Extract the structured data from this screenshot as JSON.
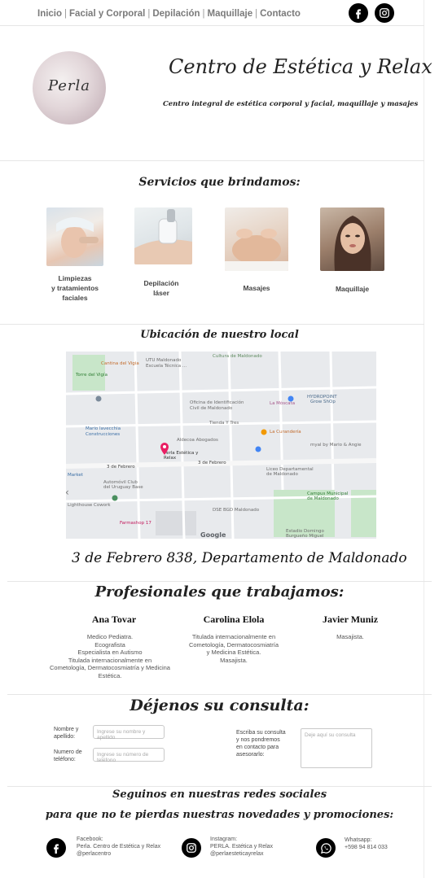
{
  "nav": {
    "items": [
      "Inicio",
      "Facial y Corporal",
      "Depilación",
      "Maquillaje",
      "Contacto"
    ],
    "separator": "|",
    "icons": [
      "facebook-icon",
      "instagram-icon"
    ]
  },
  "header": {
    "logo_text": "Perla",
    "title": "Centro de Estética y Relax",
    "subtitle": "Centro integral de estética corporal y facial, maquillaje y masajes"
  },
  "services": {
    "title": "Servicios que brindamos:",
    "items": [
      {
        "line1": "Limpiezas",
        "line2": "y tratamientos",
        "line3": "faciales"
      },
      {
        "line1": "Depilación",
        "line2": "láser"
      },
      {
        "line1": "Masajes"
      },
      {
        "line1": "Maquillaje"
      }
    ]
  },
  "location": {
    "title": "Ubicación de nuestro local",
    "address": "3 de Febrero 838, Departamento de Maldonado",
    "map_labels": {
      "cantina": "Cantina del Vigia",
      "utu": "UTU Maldonado",
      "utu2": "Escuela Técnica ...",
      "cultura": "Cultura de Maldonado",
      "torre": "Torre del Vigía",
      "hydropoint": "HYDROPOINT",
      "growshop": "Grow ShOp",
      "oficina": "Oficina de Identificación",
      "civil": "Civil de Maldonado",
      "moscata": "La Mòscata",
      "tienda": "Tienda Y Tres",
      "curanderia": "La Curandería",
      "mario": "Mario Iavecchia",
      "construcciones": "Construcciones",
      "aldecoa": "Aldecoa Abogados",
      "perla": "Perla Estética y",
      "relax": "Relax",
      "myal": "myal by Mario & Angie",
      "calle": "3 de Febrero",
      "calle2": "3 de Febrero",
      "market": "Market",
      "liceo": "Liceo Departamental",
      "liceo2": "de Maldonado",
      "automovil": "Automóvil Club",
      "automovil2": "del Uruguay Base",
      "campus": "Campus Municipal",
      "campus2": "de Maldonado",
      "lighthouse": "Lighthouse Cowork",
      "dse": "DSE BGD Maldonado",
      "farmashop": "Farmashop 17",
      "estadio": "Estadio Domingo",
      "estadio2": "Burgueño Miguel",
      "google": "Google"
    }
  },
  "professionals": {
    "title": "Profesionales que trabajamos:",
    "people": [
      {
        "name": "Ana Tovar",
        "desc": [
          "Medico Pediatra.",
          "Ecografista",
          "Especialista en Autismo",
          "Titulada internacionalmente en",
          "Cometología, Dermatocosmiatría y Medicina",
          "Estética."
        ]
      },
      {
        "name": "Carolina Elola",
        "desc": [
          "Titulada internacionalmente en",
          "Cometología, Dermatocosmiatría",
          "y Medicina Estética.",
          "Masajista."
        ]
      },
      {
        "name": "Javier Muniz",
        "desc": [
          "Masajista."
        ]
      }
    ]
  },
  "contact": {
    "title": "Déjenos su consulta:",
    "name_label": [
      "Nombre y",
      "apellido:"
    ],
    "name_placeholder": "Ingrese su nombre y apellido",
    "phone_label": [
      "Numero de",
      "teléfono:"
    ],
    "phone_placeholder": "Ingrese su número de teléfono",
    "query_label": [
      "Escriba su consulta",
      "y nos pondremos",
      "en contacto para",
      "asesorarlo:"
    ],
    "query_placeholder": "Deje aquí su consulta"
  },
  "footer": {
    "title1": "Seguinos en nuestras redes sociales",
    "title2": "para que no te pierdas nuestras novedades y promociones:",
    "facebook": [
      "Facebook:",
      "Perla. Centro de Estética y Relax",
      "@perlacentro"
    ],
    "instagram": [
      "Instagram:",
      "PERLA. Estética y Relax",
      "@perlaesteticayrelax"
    ],
    "whatsapp": [
      "Whatsapp:",
      "+598 94 814 033"
    ]
  }
}
